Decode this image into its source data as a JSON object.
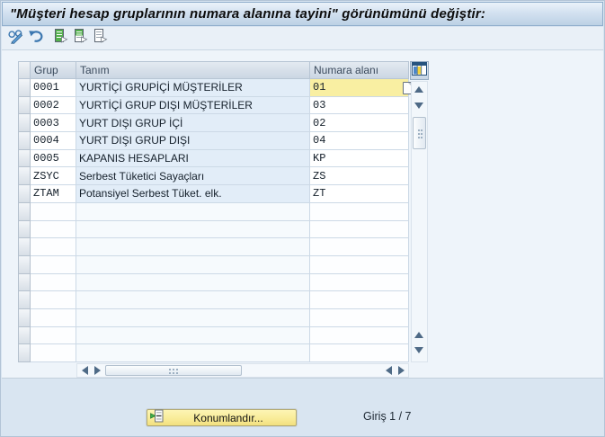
{
  "window": {
    "title": "\"Müşteri hesap gruplarının numara alanına tayini\" görünümünü değiştir:"
  },
  "toolbar": {
    "icons": [
      "change-display-toggle-icon",
      "undo-icon",
      "select-all-icon",
      "select-block-icon",
      "deselect-all-icon"
    ]
  },
  "table": {
    "columns": {
      "grup": "Grup",
      "tanim": "Tanım",
      "numara": "Numara alanı"
    },
    "config_icon": "table-settings-icon",
    "rows": [
      {
        "grup": "0001",
        "tanim": "YURTİÇİ GRUPİÇİ MÜŞTERİLER",
        "numara": "01",
        "selected": true
      },
      {
        "grup": "0002",
        "tanim": "YURTİÇİ GRUP DIŞI MÜŞTERİLER",
        "numara": "03",
        "selected": false
      },
      {
        "grup": "0003",
        "tanim": "YURT DIŞI GRUP İÇİ",
        "numara": "02",
        "selected": false
      },
      {
        "grup": "0004",
        "tanim": "YURT DIŞI GRUP DIŞI",
        "numara": "04",
        "selected": false
      },
      {
        "grup": "0005",
        "tanim": "KAPANIS HESAPLARI",
        "numara": "KP",
        "selected": false
      },
      {
        "grup": "ZSYC",
        "tanim": "Serbest Tüketici Sayaçları",
        "numara": "ZS",
        "selected": false
      },
      {
        "grup": "ZTAM",
        "tanim": "Potansiyel Serbest Tüket. elk.",
        "numara": "ZT",
        "selected": false
      }
    ],
    "empty_row_count": 9
  },
  "footer": {
    "position_button_label": "Konumlandır...",
    "entry_status": "Giriş 1 / 7"
  },
  "colors": {
    "selected_cell": "#f9efa2",
    "readonly_cell": "#e2edf8",
    "focused_button": "#f8eb96",
    "titlebar_gradient_top": "#eaf2fa",
    "titlebar_gradient_bottom": "#bcd1e5",
    "background": "#d9e5f1"
  }
}
